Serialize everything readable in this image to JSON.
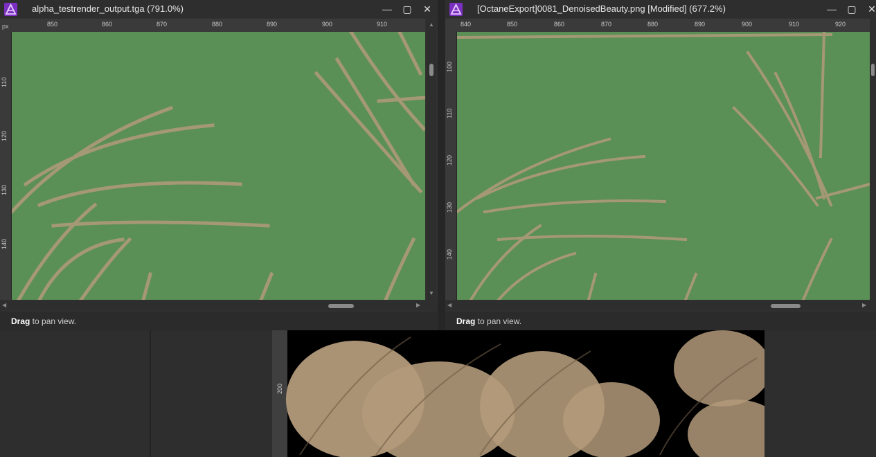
{
  "left_window": {
    "title": "alpha_testrender_output.tga (791.0%)",
    "ruler_unit": "px",
    "h_ticks": [
      "850",
      "860",
      "870",
      "880",
      "890",
      "900",
      "910"
    ],
    "v_ticks": [
      "110",
      "120",
      "130",
      "140"
    ],
    "status_action": "Drag",
    "status_text": " to pan view."
  },
  "right_window": {
    "title": "[OctaneExport]0081_DenoisedBeauty.png [Modified] (677.2%)",
    "h_ticks": [
      "840",
      "850",
      "860",
      "870",
      "880",
      "890",
      "900",
      "910",
      "920"
    ],
    "v_ticks": [
      "100",
      "110",
      "120",
      "130",
      "140"
    ],
    "status_action": "Drag",
    "status_text": " to pan view."
  },
  "bottom_view": {
    "ruler_tick": "200"
  },
  "window_controls": {
    "minimize": "—",
    "maximize": "▢",
    "close": "✕"
  },
  "colors": {
    "canvas_green": "#5a8f55",
    "app_logo": "#8b3fc9",
    "grass": "#b39a7a"
  }
}
